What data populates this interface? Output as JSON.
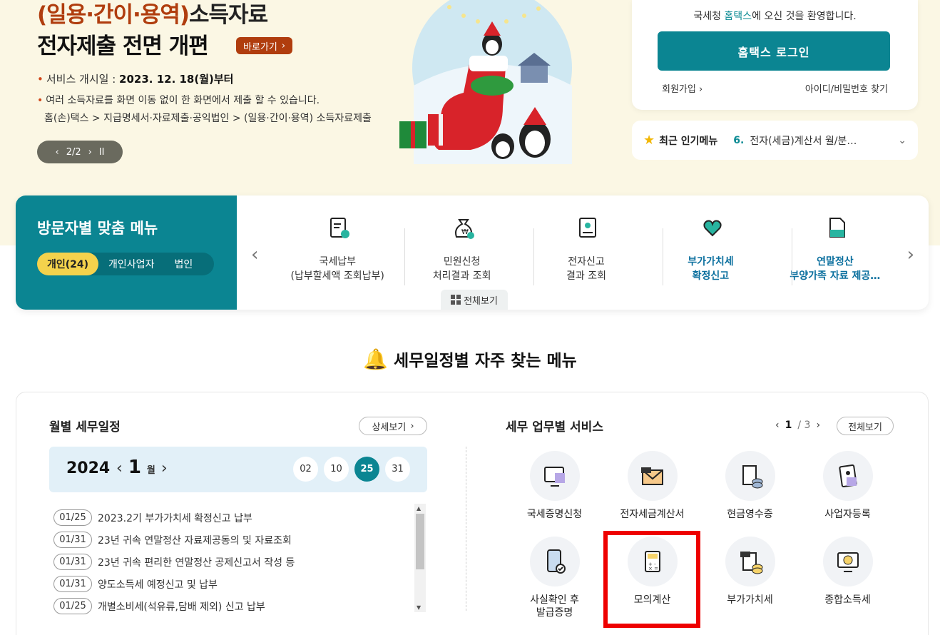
{
  "banner": {
    "title_highlight": "(일용·간이·용역)",
    "title_rest": "소득자료",
    "title_line2": "전자제출 전면 개편",
    "goto_label": "바로가기",
    "bullet1_label": "서비스 개시일 :",
    "bullet1_value": "2023. 12. 18(월)부터",
    "bullet2": "여러 소득자료를 화면 이동 없이 한 화면에서 제출 할 수 있습니다.",
    "bullet3": "홈(손)택스 > 지급명세서·자료제출·공익법인 > (일용·간이·용역) 소득자료제출",
    "pager": "2/2",
    "prev_glyph": "‹",
    "next_glyph": "›",
    "pause_glyph": "II"
  },
  "login": {
    "welcome_pre": "국세청 ",
    "welcome_brand": "홈택스",
    "welcome_post": "에 오신 것을 환영합니다.",
    "button": "홈택스 로그인",
    "signup": "회원가입",
    "find": "아이디/비밀번호 찾기"
  },
  "popular": {
    "title": "최근 인기메뉴",
    "num": "6.",
    "text": "전자(세금)계산서 월/분…"
  },
  "visitor": {
    "title": "방문자별 맞춤 메뉴",
    "tabs": [
      "개인(24)",
      "개인사업자",
      "법인"
    ],
    "items": [
      {
        "l1": "국세납부",
        "l2": "(납부할세액 조회납부)"
      },
      {
        "l1": "민원신청",
        "l2": "처리결과 조회"
      },
      {
        "l1": "전자신고",
        "l2": "결과 조회"
      },
      {
        "l1": "부가가치세",
        "l2": "확정신고"
      },
      {
        "l1": "연말정산",
        "l2": "부양가족 자료 제공…"
      }
    ],
    "all_view": "전체보기"
  },
  "section": {
    "title": "세무일정별 자주 찾는 메뉴"
  },
  "monthly": {
    "title": "월별 세무일정",
    "detail_btn": "상세보기",
    "year": "2024",
    "month": "1",
    "month_unit": "월",
    "days": [
      "02",
      "10",
      "25",
      "31"
    ],
    "selected_day": "25",
    "schedule": [
      {
        "date": "01/25",
        "text": "2023.2기 부가가치세 확정신고 납부"
      },
      {
        "date": "01/31",
        "text": "23년 귀속 연말정산 자료제공동의 및 자료조회"
      },
      {
        "date": "01/31",
        "text": "23년 귀속 편리한 연말정산 공제신고서 작성 등"
      },
      {
        "date": "01/31",
        "text": "양도소득세 예정신고 및 납부"
      },
      {
        "date": "01/25",
        "text": "개별소비세(석유류,담배 제외) 신고 납부"
      }
    ]
  },
  "services": {
    "title": "세무 업무별 서비스",
    "page_current": "1",
    "page_total": "/ 3",
    "all_view": "전체보기",
    "items": [
      "국세증명신청",
      "전자세금계산서",
      "현금영수증",
      "사업자등록",
      "사실확인 후\n발급증명",
      "모의계산",
      "부가가치세",
      "종합소득세"
    ],
    "highlighted": "모의계산"
  },
  "colors": {
    "teal": "#0b8592",
    "banner_bg": "#fbf7e4",
    "brand_orange": "#b03d0e",
    "highlight_red": "#ee0000",
    "tab_active": "#f4d24c"
  }
}
